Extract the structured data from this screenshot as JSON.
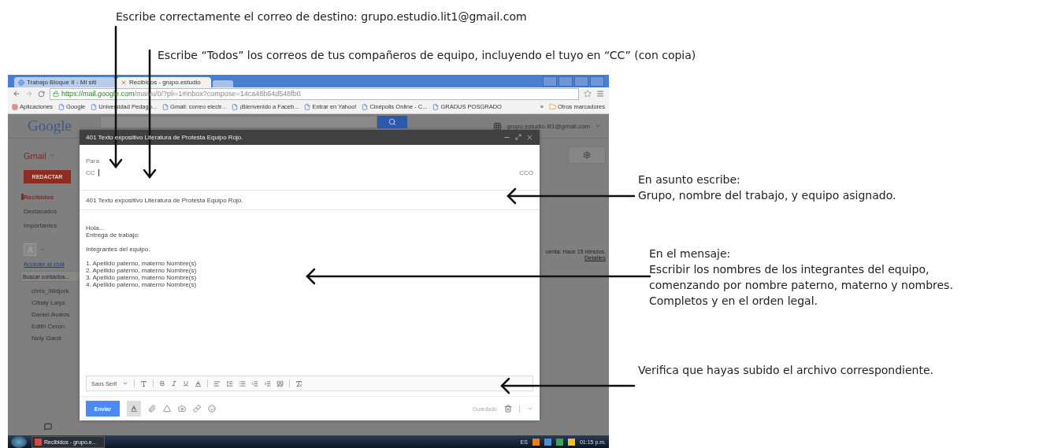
{
  "instructions": [
    {
      "text": "Escribe correctamente el correo de destino: grupo.estudio.lit1@gmail.com"
    },
    {
      "text": "Escribe “Todos” los correos de tus compañeros de equipo, incluyendo el tuyo en “CC” (con copia)"
    }
  ],
  "browser": {
    "tabs": [
      {
        "title": "Trabajo Bloque II - Mi siti",
        "selected": false
      },
      {
        "title": "Recibidos - grupo.estudio",
        "selected": true
      }
    ],
    "url_host": "https://mail.google.com",
    "url_path": "/mail/u/0/?pli=1#inbox?compose=14ca48b64d548fb0",
    "bookmarks": [
      "Aplicaciones",
      "Google",
      "Universidad Pedago...",
      "Gmail: correo electr...",
      "¡Bienvenido a Faceb...",
      "Entrar en Yahoo!",
      "Cinépolis Online - C...",
      "GRADUS POSGRADO"
    ],
    "more": "»",
    "other_bookmarks": "Otros marcadores"
  },
  "gmail": {
    "logo": "Google",
    "account": "grupo.estudio.lit1@gmail.com",
    "menu": "Gmail",
    "compose_button": "REDACTAR",
    "nav": [
      {
        "label": "Recibidos",
        "selected": true
      },
      {
        "label": "Destacados",
        "selected": false
      },
      {
        "label": "Importantes",
        "selected": false
      }
    ],
    "chat_link": "Acceder al chat",
    "contact_search": {
      "placeholder": "Buscar contactos..."
    },
    "contacts": [
      "chris_98djork",
      "Citlaly Lalyz",
      "Daniel Avalos",
      "Edith Ceron",
      "Nely Gardi"
    ],
    "activity": "uenta: Hace 15 minutos.",
    "details_link": "Detalles"
  },
  "compose": {
    "title": "401 Texto expositivo Literatura de Protesta Equipo Rojo.",
    "to_label": "Para",
    "cc_label": "CC",
    "bcc_label": "CCO",
    "subject": "401  Texto expositivo Literatura de Protesta Equipo Rojo.",
    "body": [
      [
        "Hola...",
        "Entrega de trabajo:"
      ],
      [
        "Integrantes del equipo."
      ],
      [
        "1. Apellido paterno, materno Nombre(s)",
        "2. Apellido paterno, materno Nombre(s)",
        "3. Apellido paterno, materno Nombre(s)",
        "4. Apellido paterno, materno Nombre(s)"
      ]
    ],
    "font": "Sans Serif",
    "send": "Enviar",
    "status": "Guardado"
  },
  "notes": [
    {
      "lines": [
        "En asunto escribe:",
        "Grupo, nombre del trabajo, y equipo asignado."
      ]
    },
    {
      "lines": [
        "En el mensaje:",
        "Escribir los nombres de los integrantes del equipo,",
        "comenzando por nombre paterno, materno y nombres.",
        "Completos y en el orden legal."
      ]
    },
    {
      "lines": [
        "Verifica que hayas subido el archivo correspondiente."
      ]
    }
  ],
  "taskbar": {
    "window": "Recibidos - grupo.e...",
    "language": "ES",
    "time": "01:15 p.m."
  }
}
